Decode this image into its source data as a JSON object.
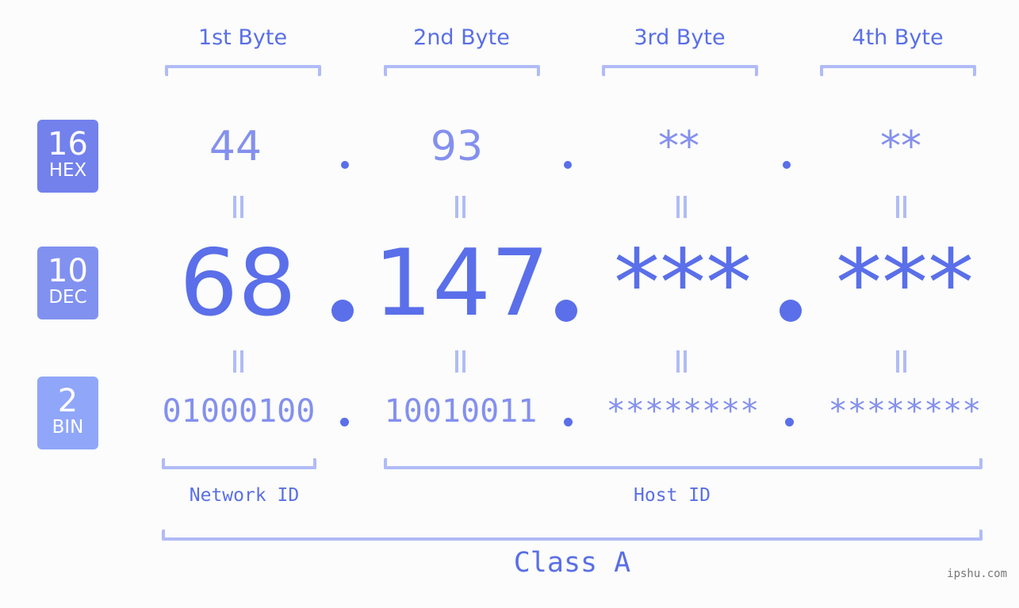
{
  "byte_headers": [
    "1st Byte",
    "2nd Byte",
    "3rd Byte",
    "4th Byte"
  ],
  "badges": {
    "hex": {
      "base": "16",
      "label": "HEX",
      "color": "#7281ec"
    },
    "dec": {
      "base": "10",
      "label": "DEC",
      "color": "#8191f0"
    },
    "bin": {
      "base": "2",
      "label": "BIN",
      "color": "#90a6f9"
    }
  },
  "hex_values": [
    "44",
    "93",
    "**",
    "**"
  ],
  "dec_values": [
    "68",
    "147",
    "***",
    "***"
  ],
  "bin_values": [
    "01000100",
    "10010011",
    "********",
    "********"
  ],
  "separator": ".",
  "equals_symbol": "=",
  "network_id_label": "Network ID",
  "host_id_label": "Host ID",
  "class_label": "Class A",
  "watermark": "ipshu.com",
  "colors": {
    "accent": "#5a6fe9",
    "light_accent": "#8490ee",
    "bracket": "#b1bbf7",
    "background": "#fbfcfb"
  }
}
